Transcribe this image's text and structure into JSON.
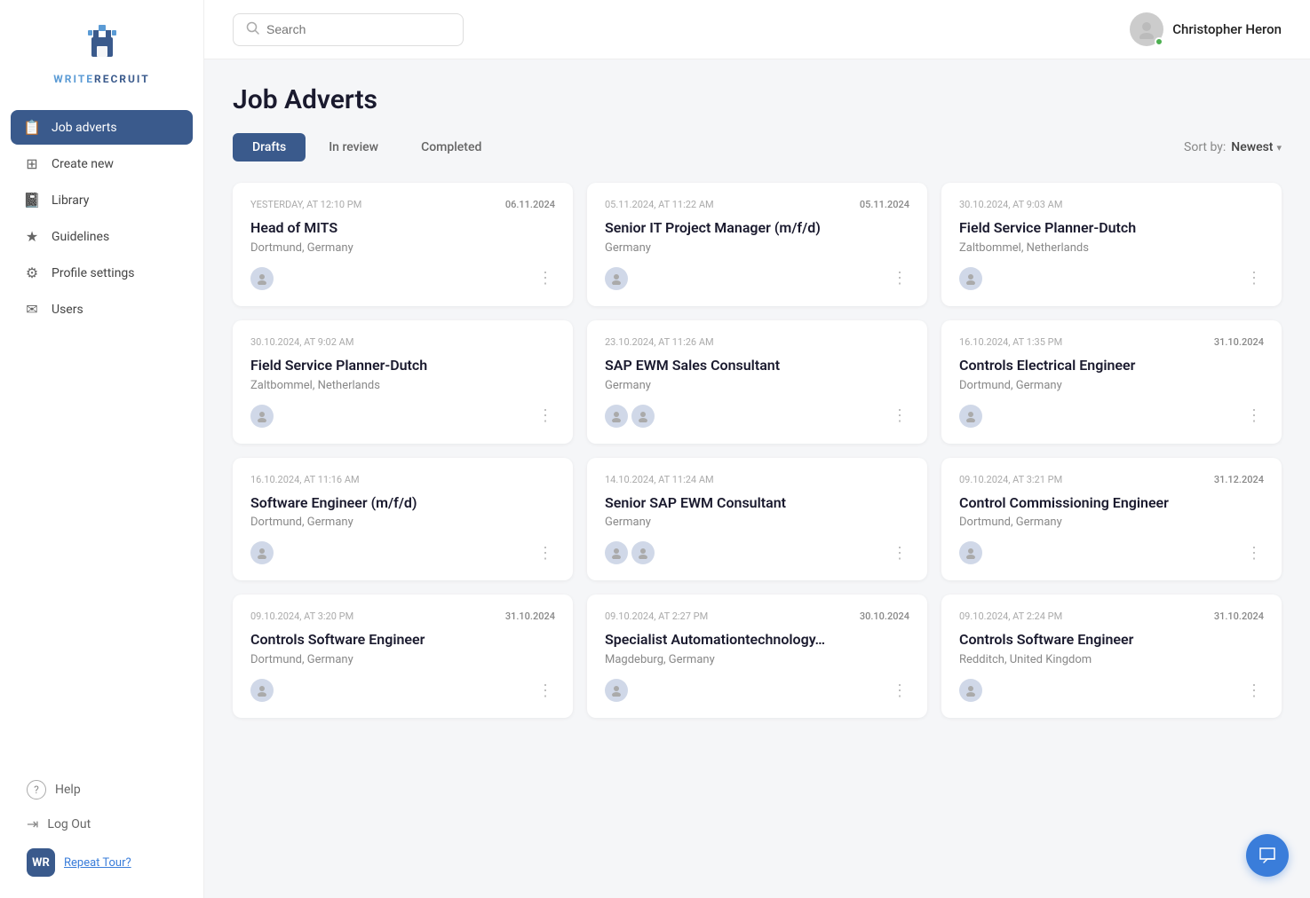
{
  "app": {
    "name": "WRITERECRUIT",
    "name_write": "WRITE",
    "name_recruit": "RECRUIT"
  },
  "sidebar": {
    "nav_items": [
      {
        "id": "job-adverts",
        "label": "Job adverts",
        "icon": "📋",
        "active": true
      },
      {
        "id": "create-new",
        "label": "Create new",
        "icon": "⊞"
      },
      {
        "id": "library",
        "label": "Library",
        "icon": "📓"
      },
      {
        "id": "guidelines",
        "label": "Guidelines",
        "icon": "★"
      },
      {
        "id": "profile-settings",
        "label": "Profile settings",
        "icon": "⚙"
      },
      {
        "id": "users",
        "label": "Users",
        "icon": "✉"
      }
    ],
    "bottom_items": [
      {
        "id": "help",
        "label": "Help",
        "icon": "?"
      },
      {
        "id": "log-out",
        "label": "Log Out",
        "icon": "→"
      }
    ],
    "badge_initials": "WR",
    "repeat_tour_label": "Repeat Tour?"
  },
  "header": {
    "search_placeholder": "Search",
    "user_name": "Christopher Heron"
  },
  "page": {
    "title": "Job Adverts",
    "tabs": [
      {
        "id": "drafts",
        "label": "Drafts",
        "active": true
      },
      {
        "id": "in-review",
        "label": "In review",
        "active": false
      },
      {
        "id": "completed",
        "label": "Completed",
        "active": false
      }
    ],
    "sort_label": "Sort by:",
    "sort_value": "Newest"
  },
  "cards": [
    {
      "date_left": "Yesterday, at 12:10 PM",
      "date_right": "06.11.2024",
      "title": "Head of MITS",
      "location": "Dortmund, Germany",
      "avatars": 1
    },
    {
      "date_left": "05.11.2024, at 11:22 AM",
      "date_right": "05.11.2024",
      "title": "Senior IT Project Manager (m/f/d)",
      "location": "Germany",
      "avatars": 1
    },
    {
      "date_left": "30.10.2024, at 9:03 AM",
      "date_right": "",
      "title": "Field Service Planner-Dutch",
      "location": "Zaltbommel, Netherlands",
      "avatars": 1
    },
    {
      "date_left": "30.10.2024, at 9:02 AM",
      "date_right": "",
      "title": "Field Service Planner-Dutch",
      "location": "Zaltbommel, Netherlands",
      "avatars": 1
    },
    {
      "date_left": "23.10.2024, at 11:26 AM",
      "date_right": "",
      "title": "SAP EWM Sales Consultant",
      "location": "Germany",
      "avatars": 2
    },
    {
      "date_left": "16.10.2024, at 1:35 PM",
      "date_right": "31.10.2024",
      "title": "Controls Electrical Engineer",
      "location": "Dortmund, Germany",
      "avatars": 1
    },
    {
      "date_left": "16.10.2024, at 11:16 AM",
      "date_right": "",
      "title": "Software Engineer (m/f/d)",
      "location": "Dortmund, Germany",
      "avatars": 1
    },
    {
      "date_left": "14.10.2024, at 11:24 AM",
      "date_right": "",
      "title": "Senior SAP EWM Consultant",
      "location": "Germany",
      "avatars": 2
    },
    {
      "date_left": "09.10.2024, at 3:21 PM",
      "date_right": "31.12.2024",
      "title": "Control Commissioning Engineer",
      "location": "Dortmund, Germany",
      "avatars": 1
    },
    {
      "date_left": "09.10.2024, at 3:20 PM",
      "date_right": "31.10.2024",
      "title": "Controls Software Engineer",
      "location": "Dortmund, Germany",
      "avatars": 1
    },
    {
      "date_left": "09.10.2024, at 2:27 PM",
      "date_right": "30.10.2024",
      "title": "Specialist Automationtechnology…",
      "location": "Magdeburg, Germany",
      "avatars": 1
    },
    {
      "date_left": "09.10.2024, at 2:24 PM",
      "date_right": "31.10.2024",
      "title": "Controls Software Engineer",
      "location": "Redditch, United Kingdom",
      "avatars": 1
    }
  ]
}
